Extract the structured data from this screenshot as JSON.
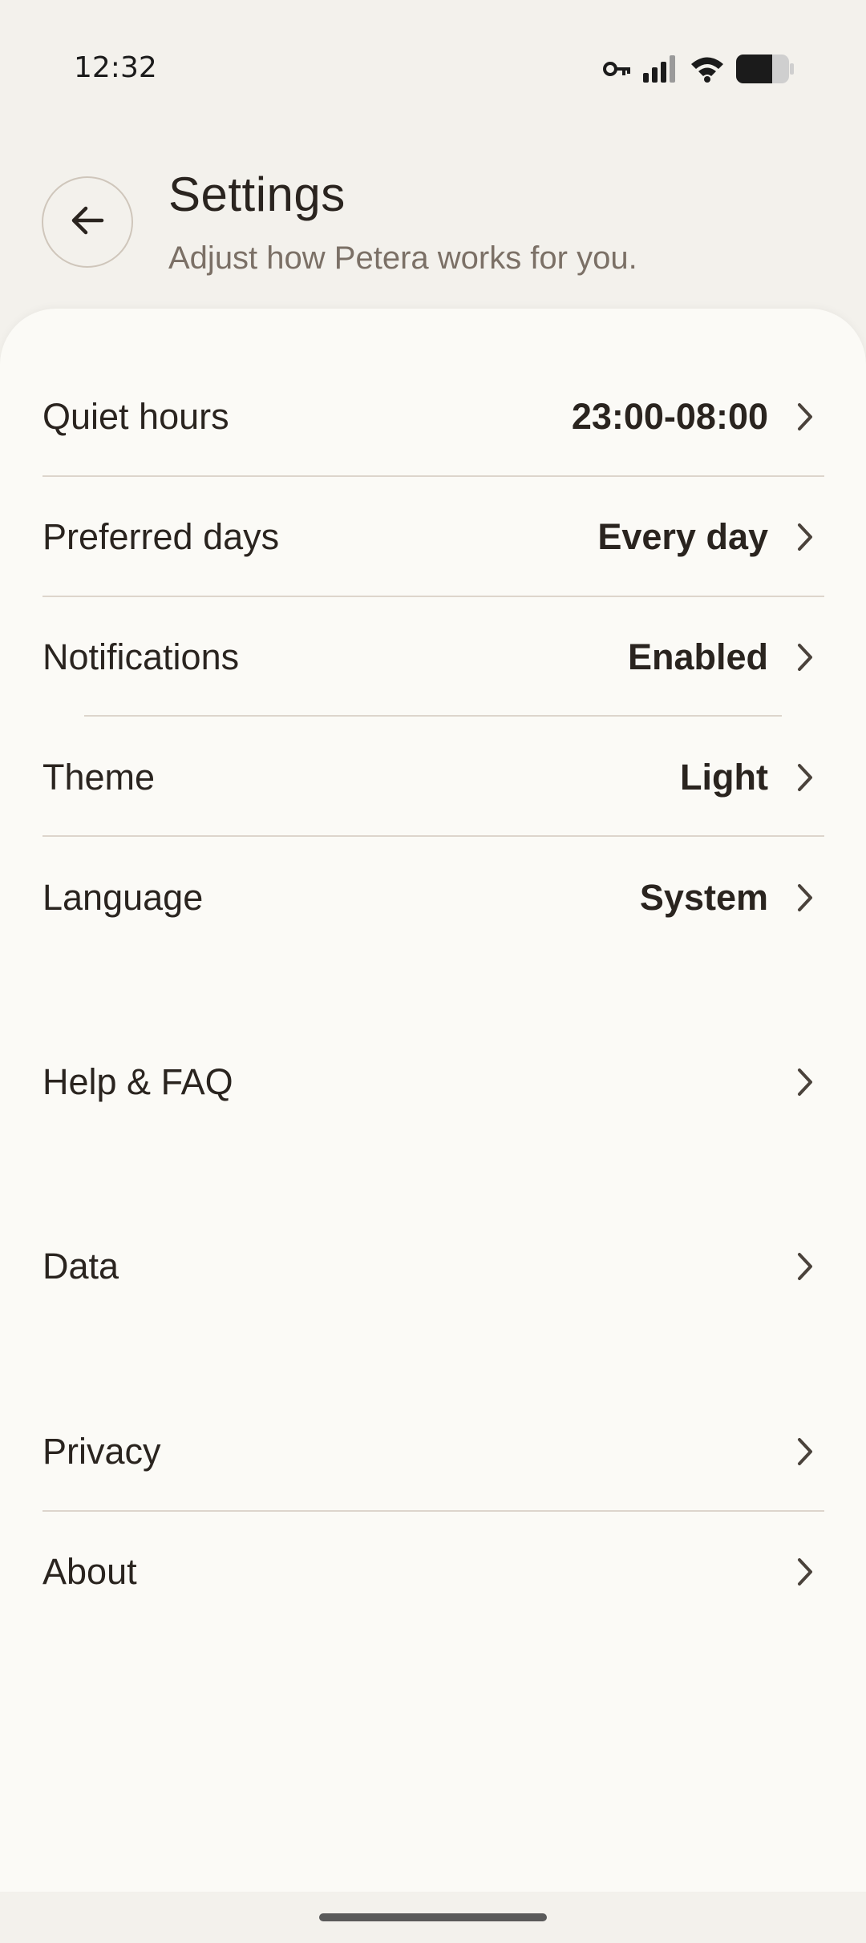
{
  "status": {
    "time": "12:32",
    "icons": [
      "vpn-key-icon",
      "signal-icon",
      "wifi-icon",
      "battery-icon"
    ]
  },
  "header": {
    "title": "Settings",
    "subtitle": "Adjust how Petera works for you."
  },
  "settings": [
    {
      "label": "Quiet hours",
      "value": "23:00-08:00"
    },
    {
      "label": "Preferred days",
      "value": "Every day"
    },
    {
      "label": "Notifications",
      "value": "Enabled"
    },
    {
      "label": "Theme",
      "value": "Light"
    },
    {
      "label": "Language",
      "value": "System"
    },
    {
      "label": "Help & FAQ",
      "value": ""
    },
    {
      "label": "Data",
      "value": ""
    },
    {
      "label": "Privacy",
      "value": ""
    },
    {
      "label": "About",
      "value": ""
    }
  ],
  "colors": {
    "background": "#f3f1ec",
    "sheet": "#fbfaf6",
    "text": "#2a241f",
    "subtitle": "#7b7066",
    "divider": "#ddd5cc"
  }
}
